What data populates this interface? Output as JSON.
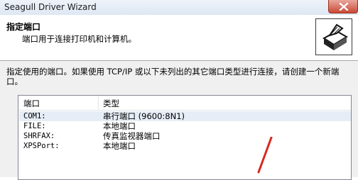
{
  "window": {
    "title": "Seagull Driver Wizard"
  },
  "header": {
    "title": "指定端口",
    "description": "端口用于连接打印机和计算机。"
  },
  "instruction": "指定使用的端口。如果使用 TCP/IP 或以下未列出的其它端口类型进行连接，请创建一个新端口。",
  "port_list": {
    "columns": [
      "端口",
      "类型"
    ],
    "rows": [
      {
        "port": "COM1:",
        "type": "串行端口 (9600:8N1)"
      },
      {
        "port": "FILE:",
        "type": "本地端口"
      },
      {
        "port": "SHRFAX:",
        "type": "传真监视器端口"
      },
      {
        "port": "XPSPort:",
        "type": "本地端口"
      }
    ]
  },
  "icons": {
    "close": "close-icon",
    "printer": "printer-icon"
  }
}
